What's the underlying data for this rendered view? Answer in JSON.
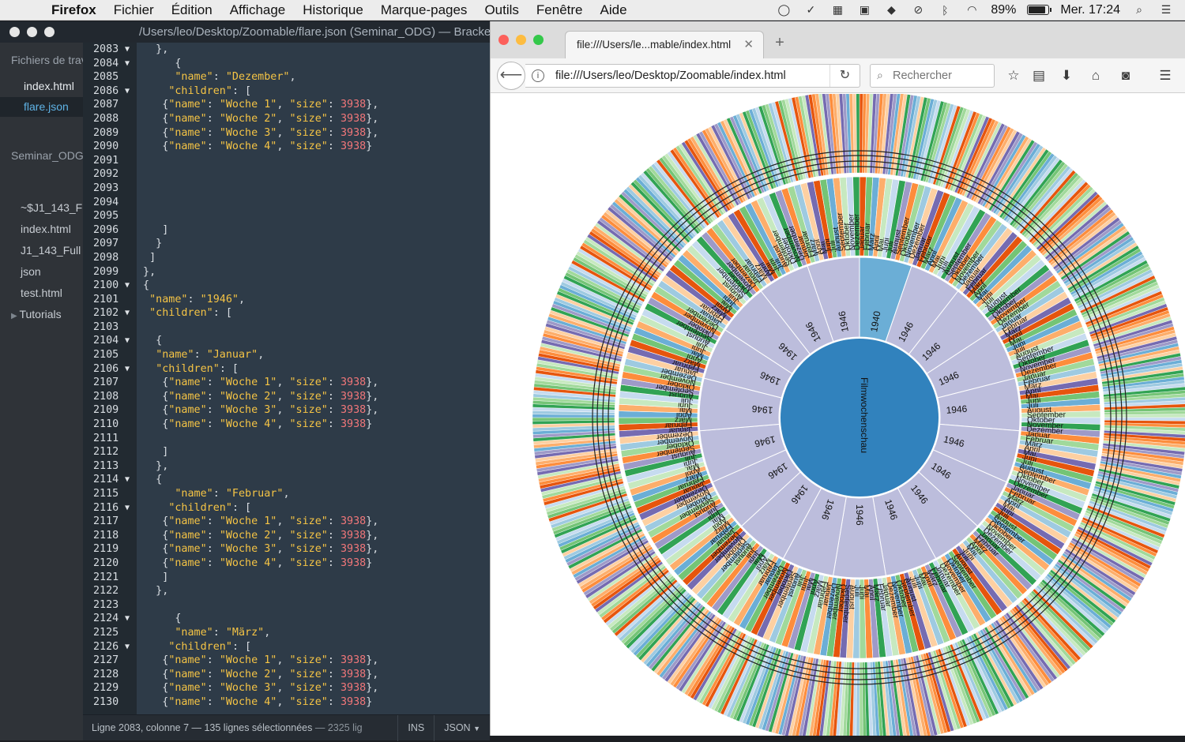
{
  "menubar": {
    "app": "Firefox",
    "menus": [
      "Fichier",
      "Édition",
      "Affichage",
      "Historique",
      "Marque-pages",
      "Outils",
      "Fenêtre",
      "Aide"
    ],
    "battery": "89%",
    "battery_level": 0.89,
    "clock": "Mer. 17:24"
  },
  "editor": {
    "title": "/Users/leo/Desktop/Zoomable/flare.json (Seminar_ODG) — Brackets",
    "sidebar": {
      "open_header": "Fichiers de travail",
      "open_files": [
        "index.html",
        "flare.json"
      ],
      "active_file": "flare.json",
      "project_header": "Seminar_ODG",
      "project_items": [
        "~$J1_143_Full",
        "index.html",
        "J1_143_Full",
        "json",
        "test.html"
      ],
      "folder": "Tutorials"
    },
    "lines": [
      {
        "n": "2083",
        "fold": true,
        "code": "   },"
      },
      {
        "n": "2084",
        "fold": true,
        "code": "      {"
      },
      {
        "n": "2085",
        "fold": false,
        "code": "      \"name\": \"Dezember\","
      },
      {
        "n": "2086",
        "fold": true,
        "code": "     \"children\": ["
      },
      {
        "n": "2087",
        "fold": false,
        "code": "    {\"name\": \"Woche 1\", \"size\": 3938},"
      },
      {
        "n": "2088",
        "fold": false,
        "code": "    {\"name\": \"Woche 2\", \"size\": 3938},"
      },
      {
        "n": "2089",
        "fold": false,
        "code": "    {\"name\": \"Woche 3\", \"size\": 3938},"
      },
      {
        "n": "2090",
        "fold": false,
        "code": "    {\"name\": \"Woche 4\", \"size\": 3938}"
      },
      {
        "n": "2091",
        "fold": false,
        "code": ""
      },
      {
        "n": "2092",
        "fold": false,
        "code": ""
      },
      {
        "n": "2093",
        "fold": false,
        "code": ""
      },
      {
        "n": "2094",
        "fold": false,
        "code": ""
      },
      {
        "n": "2095",
        "fold": false,
        "code": ""
      },
      {
        "n": "2096",
        "fold": false,
        "code": "    ]"
      },
      {
        "n": "2097",
        "fold": false,
        "code": "   }"
      },
      {
        "n": "2098",
        "fold": false,
        "code": "  ]"
      },
      {
        "n": "2099",
        "fold": false,
        "code": " },"
      },
      {
        "n": "2100",
        "fold": true,
        "code": " {"
      },
      {
        "n": "2101",
        "fold": false,
        "code": "  \"name\": \"1946\","
      },
      {
        "n": "2102",
        "fold": true,
        "code": "  \"children\": ["
      },
      {
        "n": "2103",
        "fold": false,
        "code": ""
      },
      {
        "n": "2104",
        "fold": true,
        "code": "   {"
      },
      {
        "n": "2105",
        "fold": false,
        "code": "   \"name\": \"Januar\","
      },
      {
        "n": "2106",
        "fold": true,
        "code": "   \"children\": ["
      },
      {
        "n": "2107",
        "fold": false,
        "code": "    {\"name\": \"Woche 1\", \"size\": 3938},"
      },
      {
        "n": "2108",
        "fold": false,
        "code": "    {\"name\": \"Woche 2\", \"size\": 3938},"
      },
      {
        "n": "2109",
        "fold": false,
        "code": "    {\"name\": \"Woche 3\", \"size\": 3938},"
      },
      {
        "n": "2110",
        "fold": false,
        "code": "    {\"name\": \"Woche 4\", \"size\": 3938}"
      },
      {
        "n": "2111",
        "fold": false,
        "code": ""
      },
      {
        "n": "2112",
        "fold": false,
        "code": "    ]"
      },
      {
        "n": "2113",
        "fold": false,
        "code": "   },"
      },
      {
        "n": "2114",
        "fold": true,
        "code": "   {"
      },
      {
        "n": "2115",
        "fold": false,
        "code": "      \"name\": \"Februar\","
      },
      {
        "n": "2116",
        "fold": true,
        "code": "     \"children\": ["
      },
      {
        "n": "2117",
        "fold": false,
        "code": "    {\"name\": \"Woche 1\", \"size\": 3938},"
      },
      {
        "n": "2118",
        "fold": false,
        "code": "    {\"name\": \"Woche 2\", \"size\": 3938},"
      },
      {
        "n": "2119",
        "fold": false,
        "code": "    {\"name\": \"Woche 3\", \"size\": 3938},"
      },
      {
        "n": "2120",
        "fold": false,
        "code": "    {\"name\": \"Woche 4\", \"size\": 3938}"
      },
      {
        "n": "2121",
        "fold": false,
        "code": "    ]"
      },
      {
        "n": "2122",
        "fold": false,
        "code": "   },"
      },
      {
        "n": "2123",
        "fold": false,
        "code": ""
      },
      {
        "n": "2124",
        "fold": true,
        "code": "      {"
      },
      {
        "n": "2125",
        "fold": false,
        "code": "      \"name\": \"März\","
      },
      {
        "n": "2126",
        "fold": true,
        "code": "     \"children\": ["
      },
      {
        "n": "2127",
        "fold": false,
        "code": "    {\"name\": \"Woche 1\", \"size\": 3938},"
      },
      {
        "n": "2128",
        "fold": false,
        "code": "    {\"name\": \"Woche 2\", \"size\": 3938},"
      },
      {
        "n": "2129",
        "fold": false,
        "code": "    {\"name\": \"Woche 3\", \"size\": 3938},"
      },
      {
        "n": "2130",
        "fold": false,
        "code": "    {\"name\": \"Woche 4\", \"size\": 3938}"
      }
    ],
    "status": {
      "message": "Ligne 2083, colonne 7 — 135 lignes sélectionnées",
      "count": "— 2325 lig",
      "mode": "INS",
      "language": "JSON"
    }
  },
  "browser": {
    "tab_title": "file:///Users/le...mable/index.html",
    "url": "file:///Users/leo/Desktop/Zoomable/index.html",
    "search_placeholder": "Rechercher"
  },
  "sunburst": {
    "root_label": "Filmwochenschau",
    "year_labels": [
      "1940",
      "1946",
      "1946",
      "1946",
      "1946",
      "1946",
      "1946",
      "1946",
      "1946",
      "1946",
      "1946",
      "1946",
      "1946",
      "1946",
      "1946",
      "1946",
      "1946",
      "1946",
      "1946"
    ],
    "month_labels": [
      "Januar",
      "Februar",
      "März",
      "April",
      "Mai",
      "Juni",
      "Juli",
      "August",
      "September",
      "Oktober",
      "November",
      "Dezember"
    ],
    "colors": {
      "root": "#3182bd",
      "year": "#bcbddc",
      "year_highlight": "#6baed6",
      "palette": [
        "#e6550d",
        "#fd8d3c",
        "#fdae6b",
        "#fdd0a2",
        "#31a354",
        "#74c476",
        "#a1d99b",
        "#c7e9c0",
        "#756bb1",
        "#9e9ac8",
        "#6baed6",
        "#9ecae1",
        "#c6dbef"
      ]
    }
  }
}
